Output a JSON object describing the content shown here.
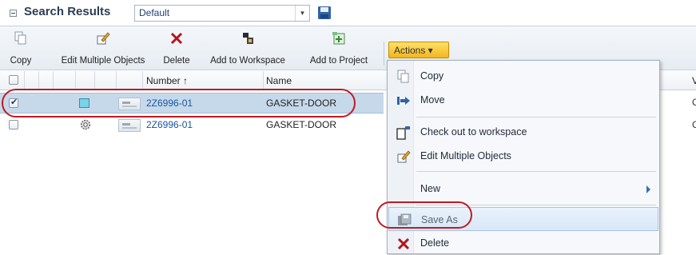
{
  "header": {
    "title": "Search Results",
    "view_select_value": "Default"
  },
  "toolbar": {
    "buttons": [
      {
        "label": "Copy"
      },
      {
        "label": "Edit Multiple Objects"
      },
      {
        "label": "Delete"
      },
      {
        "label": "Add to Workspace"
      },
      {
        "label": "Add to Project"
      }
    ],
    "actions_label": "Actions ▾"
  },
  "table": {
    "columns": {
      "number": "Number ↑",
      "name": "Name"
    },
    "rows": [
      {
        "number": "2Z6996-01",
        "name": "GASKET-DOOR",
        "checked": true
      },
      {
        "number": "2Z6996-01",
        "name": "GASKET-DOOR",
        "checked": false
      }
    ],
    "edge_header_letter": "V",
    "edge_row_letters": [
      "C",
      "C"
    ]
  },
  "actions_menu": {
    "items": [
      {
        "label": "Copy"
      },
      {
        "label": "Move"
      },
      {
        "label": "Check out to workspace"
      },
      {
        "label": "Edit Multiple Objects"
      },
      {
        "label": "New"
      },
      {
        "label": "Save As"
      },
      {
        "label": "Delete"
      }
    ]
  },
  "colors": {
    "accent": "#1a55a5",
    "selection": "#c6d9ea",
    "annotation": "#c01a22",
    "actions_button": "#f2b51d"
  }
}
